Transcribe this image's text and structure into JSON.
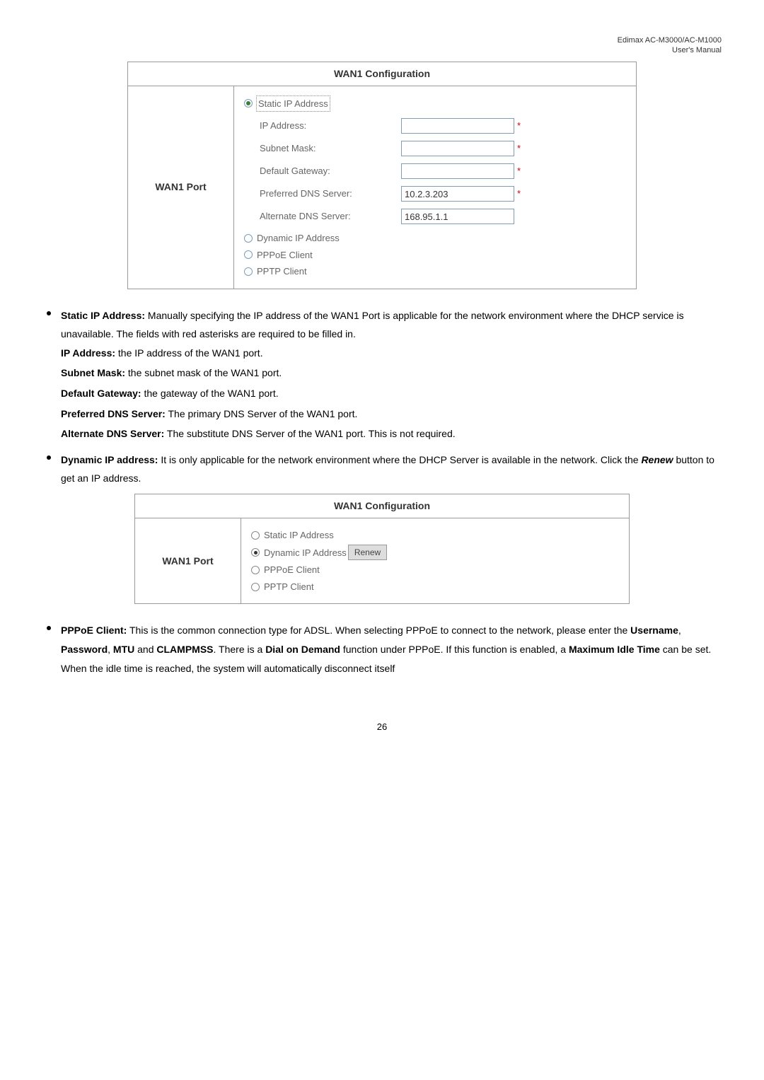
{
  "header": {
    "line1": "Edimax  AC-M3000/AC-M1000",
    "line2": "User's  Manual"
  },
  "table1": {
    "title": "WAN1 Configuration",
    "port_label": "WAN1 Port",
    "options": {
      "static": "Static IP Address",
      "dynamic": "Dynamic IP Address",
      "pppoe": "PPPoE Client",
      "pptp": "PPTP Client"
    },
    "fields": {
      "ip_label": "IP Address:",
      "ip_value": "",
      "subnet_label": "Subnet Mask:",
      "subnet_value": "",
      "gateway_label": "Default Gateway:",
      "gateway_value": "",
      "pdns_label": "Preferred DNS Server:",
      "pdns_value": "10.2.3.203",
      "adns_label": "Alternate DNS Server:",
      "adns_value": "168.95.1.1"
    },
    "asterisk": "*"
  },
  "bullets": {
    "b1_strong": "Static IP Address:",
    "b1_rest": " Manually specifying the IP address of the WAN1 Port is applicable for the network environment where the DHCP service is unavailable. The fields with red asterisks are required to be filled in.",
    "ip_strong": "IP Address:",
    "ip_rest": " the IP address of the WAN1 port.",
    "subnet_strong": "Subnet Mask:",
    "subnet_rest": " the subnet mask of the WAN1 port.",
    "gateway_strong": "Default Gateway:",
    "gateway_rest": " the gateway of the WAN1 port.",
    "pdns_strong": "Preferred DNS Server:",
    "pdns_rest": " The primary DNS Server of the WAN1 port.",
    "adns_strong": "Alternate DNS Server:",
    "adns_rest": " The substitute DNS Server of the WAN1 port. This is not required.",
    "b2_strong": "Dynamic IP address:",
    "b2_rest_a": " It is only applicable for the network environment where the DHCP Server is available in the network. Click the ",
    "b2_renew": "Renew",
    "b2_rest_b": " button to get an IP address."
  },
  "table2": {
    "title": "WAN1 Configuration",
    "port_label": "WAN1 Port",
    "options": {
      "static": "Static IP Address",
      "dynamic": "Dynamic IP Address",
      "renew_btn": "Renew",
      "pppoe": "PPPoE Client",
      "pptp": "PPTP Client"
    }
  },
  "bullet3": {
    "strong": "PPPoE Client:",
    "a": " This is the common connection type for ADSL. When selecting PPPoE to connect to the network, please enter the ",
    "username": "Username",
    "comma1": ", ",
    "password": "Password",
    "comma2": ", ",
    "mtu": "MTU",
    "and": " and ",
    "clampmss": "CLAMPMSS",
    "b": ". There is a ",
    "dod": "Dial on Demand",
    "c": " function under PPPoE. If this function is enabled, a ",
    "mit": "Maximum Idle Time",
    "d": " can be set. When the idle time is reached, the system will automatically disconnect itself"
  },
  "page_num": "26"
}
